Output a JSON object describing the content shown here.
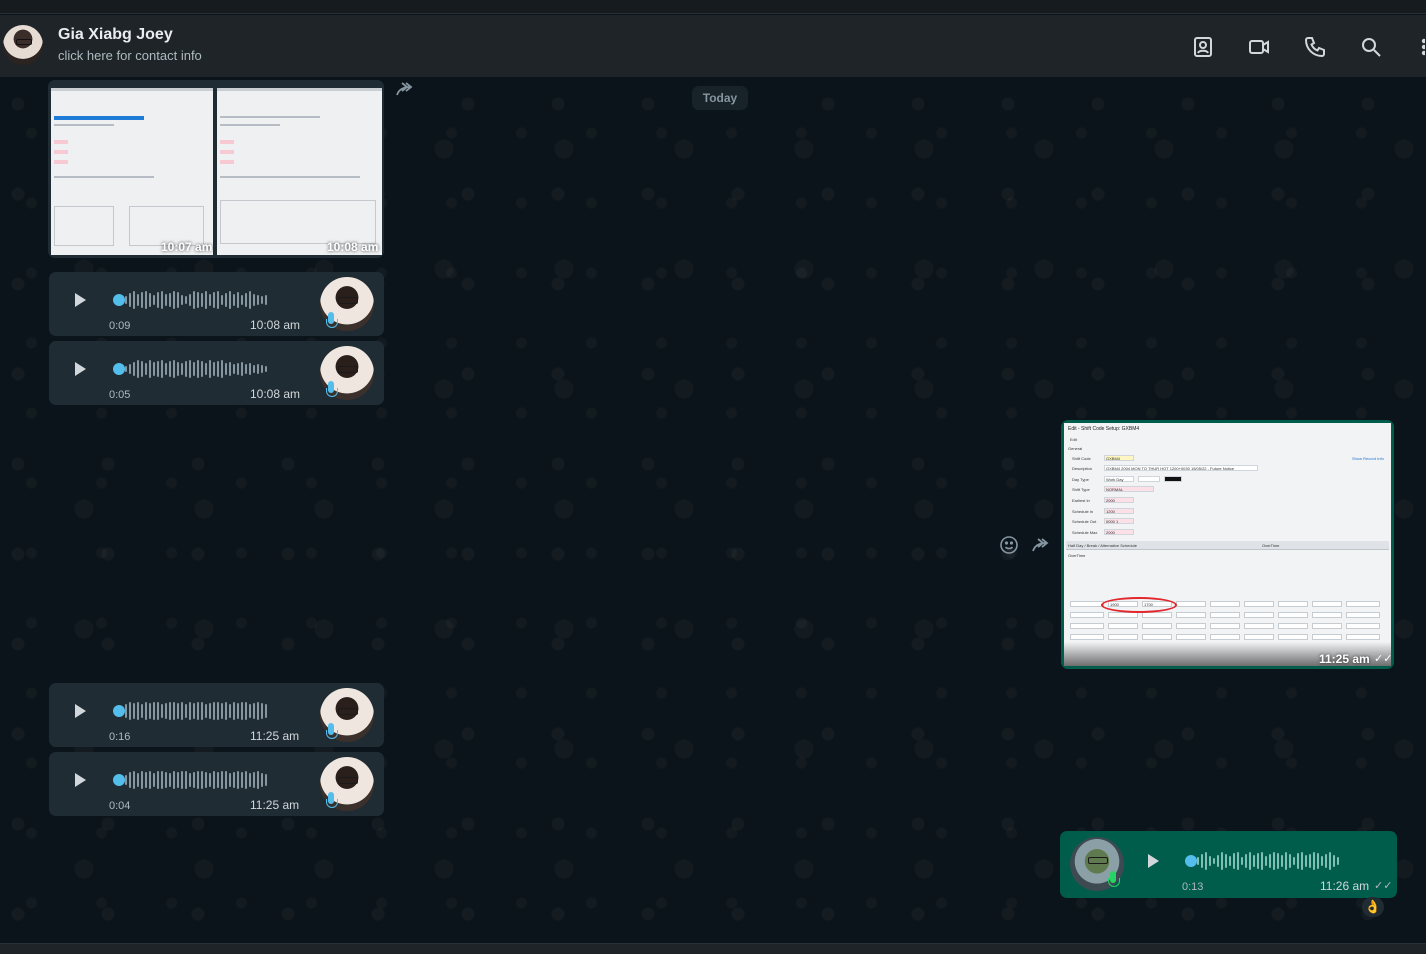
{
  "header": {
    "name": "Gia Xiabg Joey",
    "subtitle": "click here for contact info",
    "icons": [
      "contacts-icon",
      "video-call-icon",
      "voice-call-icon",
      "search-icon",
      "menu-icon"
    ]
  },
  "date_separator": "Today",
  "messages": {
    "images_left": [
      {
        "time": "10:07 am"
      },
      {
        "time": "10:08 am"
      }
    ],
    "voice_left_1": [
      {
        "duration": "0:09",
        "time": "10:08 am"
      },
      {
        "duration": "0:05",
        "time": "10:08 am"
      }
    ],
    "image_right": {
      "time": "11:25 am",
      "status": "read"
    },
    "voice_left_2": [
      {
        "duration": "0:16",
        "time": "11:25 am"
      },
      {
        "duration": "0:04",
        "time": "11:25 am"
      }
    ],
    "voice_right": {
      "duration": "0:13",
      "time": "11:26 am",
      "status": "read",
      "reaction": "👌"
    }
  },
  "screenshot_right": {
    "window_title": "Edit - Shift Code Setup: GXBM4",
    "menu": "Edit",
    "tab": "General",
    "show_record_info": "Show Record Info",
    "fields": [
      {
        "label": "Shift Code",
        "value": "GXBM4"
      },
      {
        "label": "Description",
        "value": "GXBM4 2004 MON TO THUR HOT 1200+0030 15/05/22 - Future Notice"
      },
      {
        "label": "Day Type",
        "value": "Work Day"
      },
      {
        "label": "Shift Type",
        "value": "NORMAL"
      },
      {
        "label": "Earliest In",
        "value": "2000"
      },
      {
        "label": "Schedule In",
        "value": "1200"
      },
      {
        "label": "Schedule Out",
        "value": "0000 1"
      },
      {
        "label": "Schedule Max",
        "value": "2000"
      }
    ],
    "lower_tabs": [
      "Half Day / Break / Alternative Schedule",
      "OverTime"
    ],
    "section": "OverTime",
    "time_range_values": [
      "1900",
      "1700"
    ]
  },
  "colors": {
    "incoming_bubble": "#202c33",
    "outgoing_bubble": "#005c4b",
    "accent_blue": "#53bdeb",
    "header_bg": "#1e2427"
  }
}
